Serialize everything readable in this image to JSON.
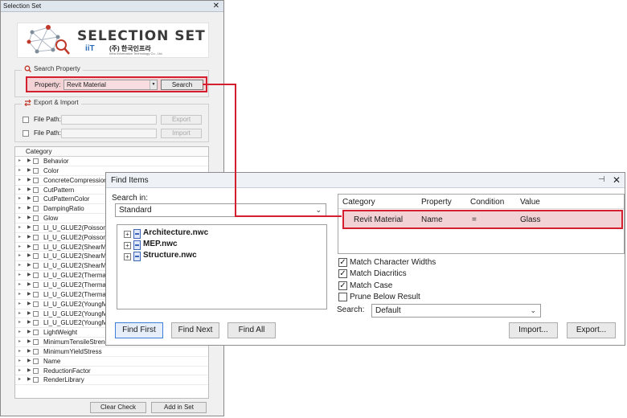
{
  "selection_set": {
    "title": "Selection Set",
    "close_glyph": "✕",
    "logo": {
      "title": "SELECTION SET",
      "company_kr": "(주) 한국인프라",
      "company_en": "Infra Information Technology Co., Ltd.",
      "mark": "iiT"
    },
    "search_property": {
      "group_label": "Search Property",
      "property_label": "Property:",
      "property_value": "Revit Material",
      "search_button": "Search"
    },
    "export_import": {
      "group_label": "Export & Import",
      "file_path_label": "File Path:",
      "export_button": "Export",
      "import_button": "Import"
    },
    "category": {
      "header": "Category",
      "items": [
        "Behavior",
        "Color",
        "ConcreteCompression",
        "CutPattern",
        "CutPatternColor",
        "DampingRatio",
        "Glow",
        "LI_U_GLUE2(PoissonM",
        "LI_U_GLUE2(PoissonM",
        "LI_U_GLUE2(ShearMo",
        "LI_U_GLUE2(ShearMo",
        "LI_U_GLUE2(ShearMo",
        "LI_U_GLUE2(ThermalE",
        "LI_U_GLUE2(ThermalE",
        "LI_U_GLUE2(ThermalE",
        "LI_U_GLUE2(YoungMo",
        "LI_U_GLUE2(YoungMo",
        "LI_U_GLUE2(YoungMo",
        "LightWeight",
        "MinimumTensileStrength",
        "MinimumYieldStress",
        "Name",
        "ReductionFactor",
        "RenderLibrary"
      ]
    },
    "clear_check_button": "Clear Check",
    "add_in_set_button": "Add in Set"
  },
  "find_items": {
    "title": "Find Items",
    "pin_glyph": "⊣",
    "close_glyph": "✕",
    "search_in_label": "Search in:",
    "search_in_value": "Standard",
    "tree": [
      "Architecture.nwc",
      "MEP.nwc",
      "Structure.nwc"
    ],
    "tree_expander": "+",
    "buttons": {
      "find_first": "Find First",
      "find_next": "Find Next",
      "find_all": "Find All",
      "import": "Import...",
      "export": "Export..."
    },
    "rule_table": {
      "headers": [
        "Category",
        "Property",
        "Condition",
        "Value"
      ],
      "row": {
        "category": "Revit Material",
        "property": "Name",
        "condition": "=",
        "value": "Glass"
      }
    },
    "options": [
      {
        "label": "Match Character Widths",
        "checked": true
      },
      {
        "label": "Match Diacritics",
        "checked": true
      },
      {
        "label": "Match Case",
        "checked": true
      },
      {
        "label": "Prune Below Result",
        "checked": false
      }
    ],
    "check_glyph": "✓",
    "search_label": "Search:",
    "search_value": "Default"
  },
  "colors": {
    "highlight_border": "#d31f2e",
    "highlight_fill": "#f3d2d6"
  }
}
